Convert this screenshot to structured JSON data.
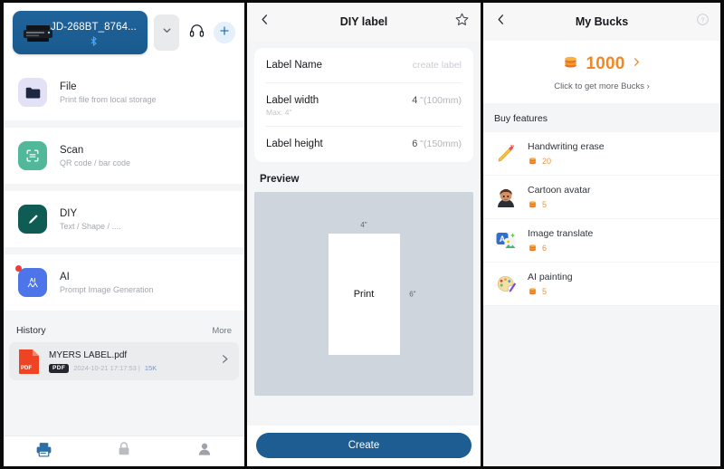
{
  "panel1": {
    "device": {
      "name": "JD-268BT_8764...",
      "printer_icon": "printer-icon",
      "bluetooth_icon": "bluetooth-icon",
      "chevron_icon": "chevron-down-icon"
    },
    "header_icons": {
      "support": "headset-icon",
      "add": "plus-icon"
    },
    "menu": [
      {
        "title": "File",
        "subtitle": "Print file from local storage",
        "icon": "folder-icon",
        "badge": false
      },
      {
        "title": "Scan",
        "subtitle": "QR code / bar code",
        "icon": "scan-frame-icon",
        "badge": false
      },
      {
        "title": "DIY",
        "subtitle": "Text / Shape / ....",
        "icon": "pencil-icon",
        "badge": false
      },
      {
        "title": "AI",
        "subtitle": "Prompt Image Generation",
        "icon": "ai-icon",
        "badge": true
      }
    ],
    "history": {
      "title": "History",
      "more": "More",
      "item": {
        "name": "MYERS LABEL.pdf",
        "badge": "PDF",
        "date": "2024-10-21 17:17:53  |",
        "size": "15K",
        "file_icon": "pdf-file-icon",
        "chevron": "chevron-right-icon"
      }
    },
    "tabs": [
      {
        "name": "printer",
        "icon": "printer-tab-icon",
        "active": true
      },
      {
        "name": "store",
        "icon": "lock-tab-icon",
        "active": false
      },
      {
        "name": "profile",
        "icon": "person-tab-icon",
        "active": false
      }
    ]
  },
  "panel2": {
    "nav": {
      "title": "DIY label",
      "back_icon": "chevron-left-icon",
      "favorite_icon": "star-icon"
    },
    "form": {
      "label_name": {
        "label": "Label Name",
        "placeholder": "create label",
        "value": ""
      },
      "label_width": {
        "label": "Label width",
        "value": "4",
        "unit": " \"(100mm)",
        "hint": "Max: 4\""
      },
      "label_height": {
        "label": "Label height",
        "value": "6",
        "unit": " \"(150mm)"
      }
    },
    "preview": {
      "title": "Preview",
      "sheet_text": "Print",
      "dim_width": "4\"",
      "dim_height": "6\""
    },
    "create_button": "Create"
  },
  "panel3": {
    "nav": {
      "title": "My Bucks",
      "back_icon": "chevron-left-icon",
      "help_icon": "question-mark-icon"
    },
    "balance": {
      "amount": "1000",
      "coin_icon": "coin-stack-icon",
      "chevron": "chevron-right-icon",
      "link": "Click to get more Bucks ›"
    },
    "section_title": "Buy features",
    "features": [
      {
        "title": "Handwriting erase",
        "price": "20",
        "icon": "pencil-eraser-icon"
      },
      {
        "title": "Cartoon avatar",
        "price": "5",
        "icon": "avatar-icon"
      },
      {
        "title": "Image translate",
        "price": "6",
        "icon": "translate-icon"
      },
      {
        "title": "AI painting",
        "price": "5",
        "icon": "palette-icon"
      }
    ]
  },
  "colors": {
    "accent_blue": "#1e5d91",
    "accent_orange": "#f08828",
    "preview_bg": "#ced5dd",
    "page_bg": "#f4f5f7"
  }
}
